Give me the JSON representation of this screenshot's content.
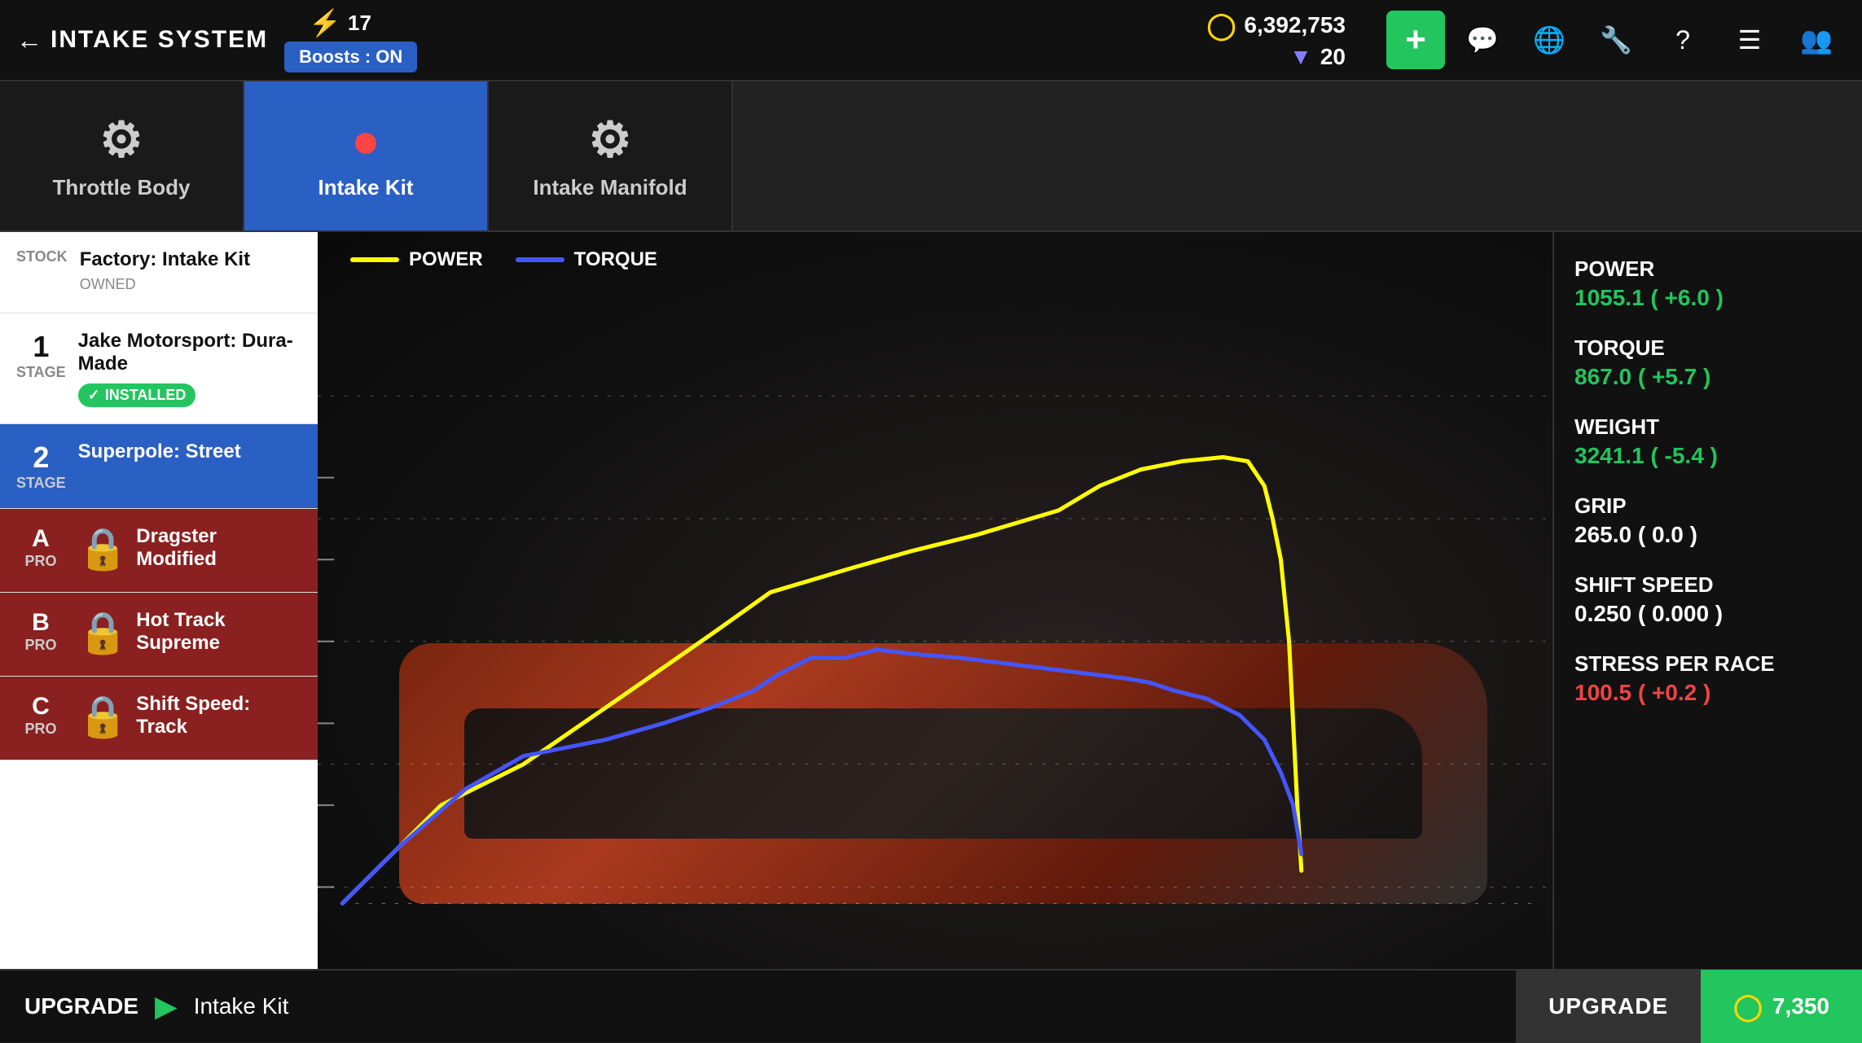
{
  "topBar": {
    "backLabel": "INTAKE SYSTEM",
    "lightningCount": "17",
    "boostLabel": "Boosts : ON",
    "coins": "6,392,753",
    "gems": "20",
    "addIcon": "+",
    "chatIcon": "💬",
    "globeIcon": "🌐",
    "wrenchIcon": "🔧",
    "questionIcon": "?",
    "menuIcon": "☰",
    "peopleIcon": "👥"
  },
  "partTabs": [
    {
      "id": "throttle-body",
      "label": "Throttle Body",
      "active": false,
      "icon": "⚙"
    },
    {
      "id": "intake-kit",
      "label": "Intake Kit",
      "active": true,
      "icon": "🔴"
    },
    {
      "id": "intake-manifold",
      "label": "Intake Manifold",
      "active": false,
      "icon": "⚙"
    }
  ],
  "upgradeItems": [
    {
      "id": "stock",
      "stageNum": "",
      "stageLabel": "STOCK",
      "name": "Factory: Intake Kit",
      "sub": "OWNED",
      "status": "owned",
      "selected": false,
      "locked": false,
      "proLabel": ""
    },
    {
      "id": "stage1",
      "stageNum": "1",
      "stageLabel": "STAGE",
      "name": "Jake Motorsport: Dura-Made",
      "sub": "INSTALLED",
      "status": "installed",
      "selected": false,
      "locked": false,
      "proLabel": ""
    },
    {
      "id": "stage2",
      "stageNum": "2",
      "stageLabel": "STAGE",
      "name": "Superpole: Street",
      "sub": "",
      "status": "selected",
      "selected": true,
      "locked": false,
      "proLabel": ""
    },
    {
      "id": "pro-a",
      "stageNum": "A",
      "stageLabel": "PRO",
      "name": "Dragster Modified",
      "sub": "",
      "status": "locked",
      "selected": false,
      "locked": true,
      "proLabel": "A"
    },
    {
      "id": "pro-b",
      "stageNum": "B",
      "stageLabel": "PRO",
      "name": "Hot Track Supreme",
      "sub": "",
      "status": "locked",
      "selected": false,
      "locked": true,
      "proLabel": "B"
    },
    {
      "id": "pro-c",
      "stageNum": "C",
      "stageLabel": "PRO",
      "name": "Shift Speed: Track",
      "sub": "",
      "status": "locked",
      "selected": false,
      "locked": true,
      "proLabel": "C"
    }
  ],
  "graph": {
    "powerLabel": "POWER",
    "torqueLabel": "TORQUE"
  },
  "stats": {
    "power": {
      "label": "POWER",
      "value": "1055.1 ( +6.0 )",
      "color": "green"
    },
    "torque": {
      "label": "TORQUE",
      "value": "867.0 ( +5.7 )",
      "color": "green"
    },
    "weight": {
      "label": "WEIGHT",
      "value": "3241.1 ( -5.4 )",
      "color": "green"
    },
    "grip": {
      "label": "GRIP",
      "value": "265.0 ( 0.0 )",
      "color": "white"
    },
    "shiftSpeed": {
      "label": "SHIFT SPEED",
      "value": "0.250 ( 0.000 )",
      "color": "white"
    },
    "stressPerRace": {
      "label": "STRESS PER RACE",
      "value": "100.5 ( +0.2 )",
      "color": "red"
    }
  },
  "bottomBar": {
    "upgradeLabel": "UPGRADE",
    "itemLabel": "Intake Kit",
    "upgradeBtn": "UPGRADE",
    "cost": "7,350"
  }
}
